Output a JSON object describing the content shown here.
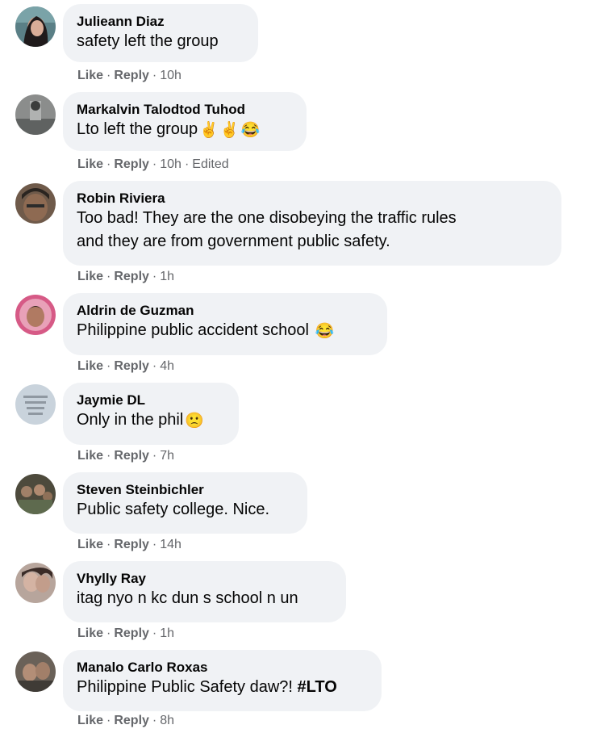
{
  "comments": [
    {
      "author": "Julieann Diaz",
      "text": "safety left the group",
      "like": "Like",
      "reply": "Reply",
      "time": "10h"
    },
    {
      "author": "Markalvin Talodtod Tuhod",
      "text": "Lto left the group",
      "emoji": [
        "✌",
        "✌",
        "😂"
      ],
      "like": "Like",
      "reply": "Reply",
      "time": "10h",
      "edited": "Edited"
    },
    {
      "author": "Robin Riviera",
      "text_line1": "Too bad! They are the one disobeying the traffic rules",
      "text_line2": "and they are from government public safety.",
      "like": "Like",
      "reply": "Reply",
      "time": "1h"
    },
    {
      "author": "Aldrin de Guzman",
      "text": "Philippine public accident school",
      "emoji": [
        "😂"
      ],
      "like": "Like",
      "reply": "Reply",
      "time": "4h"
    },
    {
      "author": "Jaymie DL",
      "text": "Only in the phil",
      "emoji": [
        "🙁"
      ],
      "like": "Like",
      "reply": "Reply",
      "time": "7h"
    },
    {
      "author": "Steven Steinbichler",
      "text": "Public safety college. Nice.",
      "like": "Like",
      "reply": "Reply",
      "time": "14h"
    },
    {
      "author": "Vhylly Ray",
      "text": "itag nyo n kc dun s school n un",
      "like": "Like",
      "reply": "Reply",
      "time": "1h"
    },
    {
      "author": "Manalo Carlo Roxas",
      "text": "Philippine Public Safety daw?!",
      "hashtag": "#LTO",
      "like": "Like",
      "reply": "Reply",
      "time": "8h"
    }
  ],
  "colors": {
    "bubble": "#f0f2f5",
    "author": "#050505",
    "meta": "#65676b"
  }
}
